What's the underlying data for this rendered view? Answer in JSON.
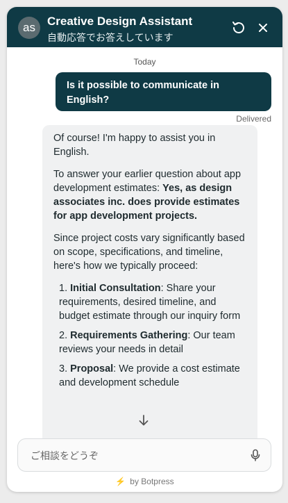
{
  "header": {
    "avatar_text": "as",
    "title": "Creative Design Assistant",
    "subtitle": "自動応答でお答えしています"
  },
  "messages": {
    "date_label": "Today",
    "user_message": "Is it possible to communicate in English?",
    "delivered_label": "Delivered",
    "bot": {
      "para1": "Of course! I'm happy to assist you in English.",
      "para2_prefix": "To answer your earlier question about app development estimates: ",
      "para2_bold": "Yes, as design associates inc. does provide estimates for app development projects.",
      "para3": "Since project costs vary significantly based on scope, specifications, and timeline, here's how we typically proceed:",
      "steps": [
        {
          "num": "1. ",
          "title": "Initial Consultation",
          "text": ": Share your requirements, desired timeline, and budget estimate through our inquiry form"
        },
        {
          "num": "2. ",
          "title": "Requirements Gathering",
          "text": ": Our team reviews your needs in detail"
        },
        {
          "num": "3. ",
          "title": "Proposal",
          "text": ": We provide a cost estimate and development schedule"
        }
      ]
    }
  },
  "composer": {
    "placeholder": "ご相談をどうぞ"
  },
  "footer": {
    "text": "by Botpress"
  },
  "colors": {
    "header_bg": "#0f3a45",
    "user_bubble": "#0f3a45",
    "bot_bubble": "#f0f1f2",
    "brand_bolt": "#f28a1c"
  },
  "icons": [
    "refresh-icon",
    "close-icon",
    "arrow-down-icon",
    "microphone-icon",
    "bolt-icon"
  ]
}
